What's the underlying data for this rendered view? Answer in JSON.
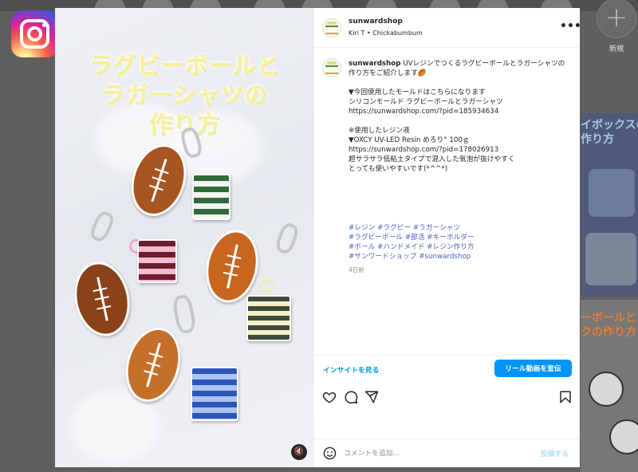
{
  "background": {
    "new_label": "新規",
    "tile1_title": "イボックスの\n作り方",
    "tile2_title": "ーボールと\nクの作り方"
  },
  "post": {
    "image_heading": [
      "ラグビーボールと",
      "ラガーシャツの",
      "作り方"
    ],
    "mute_icon": "volume-off-icon"
  },
  "header": {
    "username": "sunwardshop",
    "subtitle": "Kiri T • Chickabumbum",
    "more_icon": "more-horizontal-icon"
  },
  "caption": {
    "username": "sunwardshop",
    "lines": [
      "UVレジンでつくるラグビーボールとラガーシャツの作り方をご紹介します🏉",
      "",
      "▼今回使用したモールドはこちらになります",
      "シリコンモールド ラグビーボールとラガーシャツ",
      "https://sunwardshop.com/?pid=185934634",
      "",
      "※使用したレジン液",
      "▼OXCY UV-LED Resin めろり° 100ｇ",
      "https://sunwardshop.com/?pid=178026913",
      "超サラサラ低粘土タイプで混入した気泡が抜けやすく",
      "とっても使いやすいです(*^^*)"
    ],
    "hashtag_lines": [
      "#レジン #ラグビー #ラガーシャツ",
      "#ラグビーボール #部活 #キーホルダー",
      "#ボール #ハンドメイド #レジン作り方",
      "#サンワードショップ #sunwardshop"
    ],
    "time_ago": "4日前"
  },
  "insights": {
    "link_label": "インサイトを見る",
    "promote_label": "リール動画を宣伝"
  },
  "actions": [
    "heart-icon",
    "comment-icon",
    "share-icon",
    "bookmark-icon"
  ],
  "comment": {
    "placeholder": "コメントを追加...",
    "post_label": "投稿する"
  },
  "colors": {
    "accent": "#0095f6",
    "hashtag": "#4f5ec0",
    "heading_text": "#f6ef9a"
  }
}
